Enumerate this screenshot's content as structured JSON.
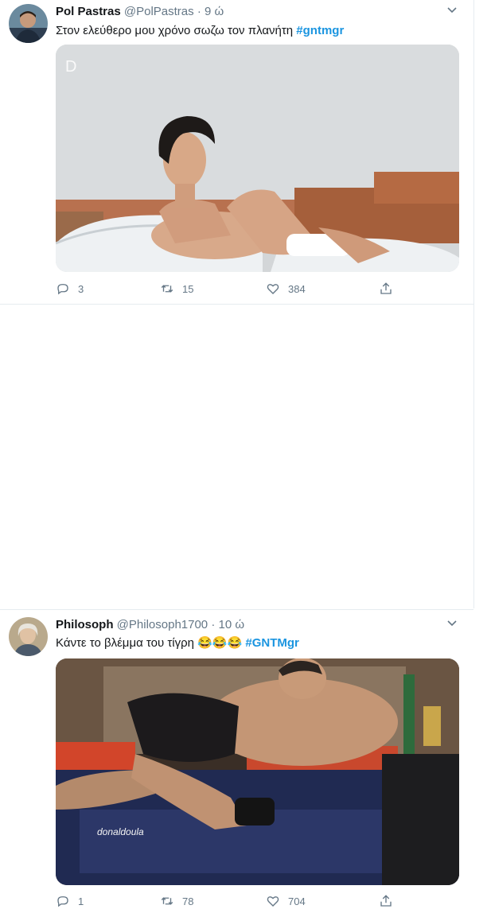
{
  "tweets": [
    {
      "name": "Pol Pastras",
      "handle": "@PolPastras",
      "separator": "·",
      "time": "9 ώ",
      "text": "Στον ελεύθερο μου χρόνο σωζω τον πλανήτη",
      "hashtag": "#gntmgr",
      "media_badge": "D",
      "replies": "3",
      "retweets": "15",
      "likes": "384"
    },
    {
      "name": "Philosoph",
      "handle": "@Philosoph1700",
      "separator": "·",
      "time": "10 ώ",
      "text": "Κάντε το βλέμμα του τίγρη 😂😂😂",
      "hashtag": "#GNTMgr",
      "media_watermark": "donaldoula",
      "replies": "1",
      "retweets": "78",
      "likes": "704"
    }
  ],
  "icons": {
    "reply": "reply-icon",
    "retweet": "retweet-icon",
    "like": "heart-icon",
    "share": "share-icon",
    "more": "chevron-down-icon"
  },
  "colors": {
    "accent": "#1b95e0",
    "secondary_text": "#657786",
    "divider": "#e6ecf0"
  }
}
